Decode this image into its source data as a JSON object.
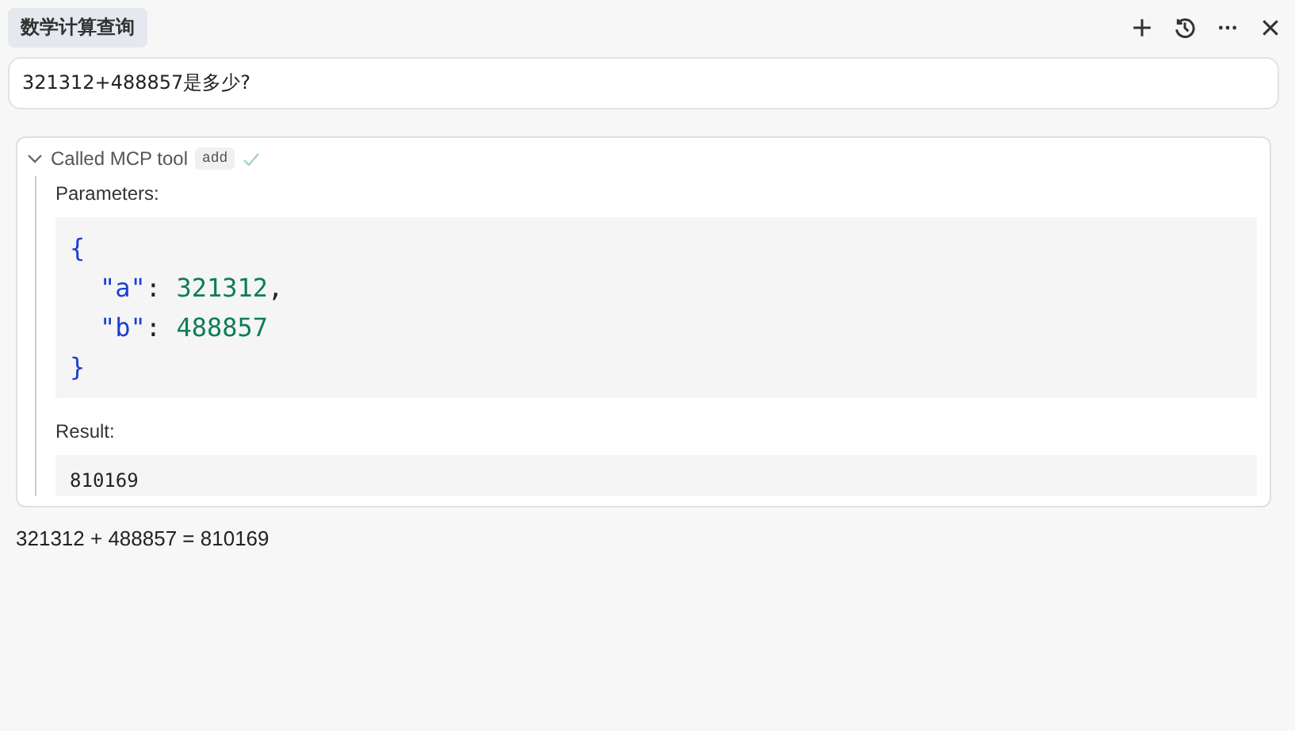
{
  "tab": {
    "title": "数学计算查询"
  },
  "toolbar": [
    {
      "kind": "plus"
    },
    {
      "kind": "history"
    },
    {
      "kind": "more"
    },
    {
      "kind": "close"
    }
  ],
  "prompt": {
    "value": "321312+488857是多少?"
  },
  "tool_call": {
    "expanded": true,
    "label": "Called MCP tool",
    "tool": "add",
    "done": true,
    "parameters_label": "Parameters:",
    "parameters": {
      "open": "{",
      "close": "}",
      "entries": [
        {
          "key": "\"a\"",
          "sep": ":",
          "value": "321312",
          "trail": ","
        },
        {
          "key": "\"b\"",
          "sep": ":",
          "value": "488857"
        }
      ]
    },
    "result_label": "Result:",
    "result": "810169"
  },
  "answer": "321312 + 488857 = 810169"
}
